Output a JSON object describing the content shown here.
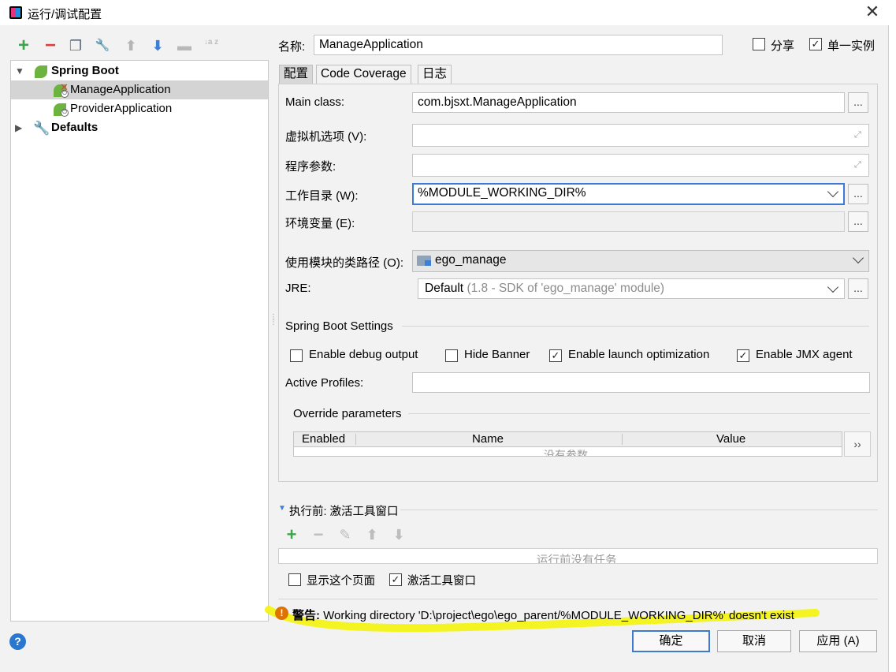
{
  "window": {
    "title": "运行/调试配置",
    "close_glyph": "✕"
  },
  "toolbar": {
    "add": "+",
    "remove": "−",
    "copy": "❐",
    "edit": "🔧",
    "up": "⬆",
    "down": "⬇",
    "folder": "▬",
    "sort": "↓a z",
    "icons": [
      "add-icon",
      "remove-icon",
      "copy-icon",
      "wrench-icon",
      "move-up-icon",
      "move-down-icon",
      "folder-icon",
      "sort-icon"
    ]
  },
  "tree": {
    "root": "Spring Boot",
    "items": [
      "ManageApplication",
      "ProviderApplication"
    ],
    "defaults": "Defaults"
  },
  "header": {
    "name_label": "名称:",
    "name_value": "ManageApplication",
    "share_label": "分享",
    "single_instance_label": "单一实例",
    "share_checked": false,
    "single_instance_checked": true
  },
  "tabs": [
    "配置",
    "Code Coverage",
    "日志"
  ],
  "form": {
    "main_class_label": "Main class:",
    "main_class_value": "com.bjsxt.ManageApplication",
    "vm_options_label": "虚拟机选项 (V):",
    "vm_options_value": "",
    "program_args_label": "程序参数:",
    "program_args_value": "",
    "working_dir_label": "工作目录 (W):",
    "working_dir_value": "%MODULE_WORKING_DIR%",
    "env_label": "环境变量 (E):",
    "env_value": "",
    "module_label": "使用模块的类路径 (O):",
    "module_value": "ego_manage",
    "jre_label": "JRE:",
    "jre_value": "Default",
    "jre_hint": "(1.8 - SDK of 'ego_manage' module)",
    "browse": "..."
  },
  "springboot": {
    "section_title": "Spring Boot Settings",
    "debug_output": "Enable debug output",
    "hide_banner": "Hide Banner",
    "launch_opt": "Enable launch optimization",
    "jmx_agent": "Enable JMX agent",
    "debug_checked": false,
    "hide_banner_checked": false,
    "launch_opt_checked": true,
    "jmx_checked": true,
    "active_profiles_label": "Active Profiles:",
    "active_profiles_value": "",
    "override_title": "Override parameters",
    "columns": [
      "Enabled",
      "Name",
      "Value"
    ],
    "empty_text": "没有参数",
    "more": "››"
  },
  "before_launch": {
    "title": "执行前: 激活工具窗口",
    "add": "+",
    "remove": "−",
    "edit": "✎",
    "up": "⬆",
    "down": "⬇",
    "empty_text": "运行前没有任务",
    "show_page_label": "显示这个页面",
    "activate_window_label": "激活工具窗口",
    "show_page_checked": false,
    "activate_window_checked": true
  },
  "warning": {
    "prefix": "警告:",
    "message": "Working directory 'D:\\project\\ego\\ego_parent/%MODULE_WORKING_DIR%' doesn't exist"
  },
  "buttons": {
    "ok": "确定",
    "cancel": "取消",
    "apply": "应用 (A)",
    "help": "?"
  },
  "colors": {
    "accent": "#3e7bd0",
    "spring_green": "#6db33f",
    "highlight": "#f3f316",
    "warning": "#e07300"
  }
}
